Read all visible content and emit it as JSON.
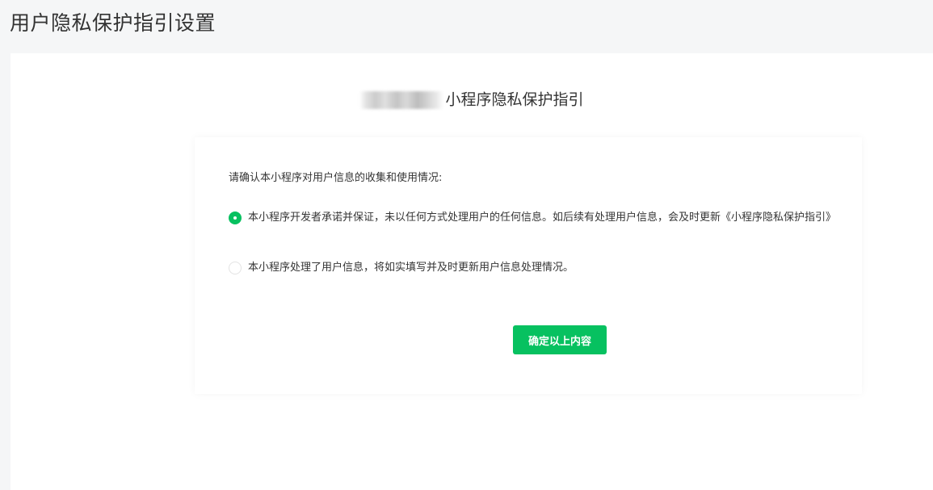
{
  "page": {
    "title": "用户隐私保护指引设置"
  },
  "guide": {
    "heading": "小程序隐私保护指引"
  },
  "card": {
    "prompt": "请确认本小程序对用户信息的收集和使用情况:",
    "options": [
      {
        "label": "本小程序开发者承诺并保证，未以任何方式处理用户的任何信息。如后续有处理用户信息，会及时更新《小程序隐私保护指引》",
        "selected": true
      },
      {
        "label": "本小程序处理了用户信息，将如实填写并及时更新用户信息处理情况。",
        "selected": false
      }
    ],
    "confirm_label": "确定以上内容"
  },
  "colors": {
    "accent": "#07c160",
    "page_background": "#f5f6f7",
    "panel_background": "#ffffff",
    "text": "#353535"
  }
}
